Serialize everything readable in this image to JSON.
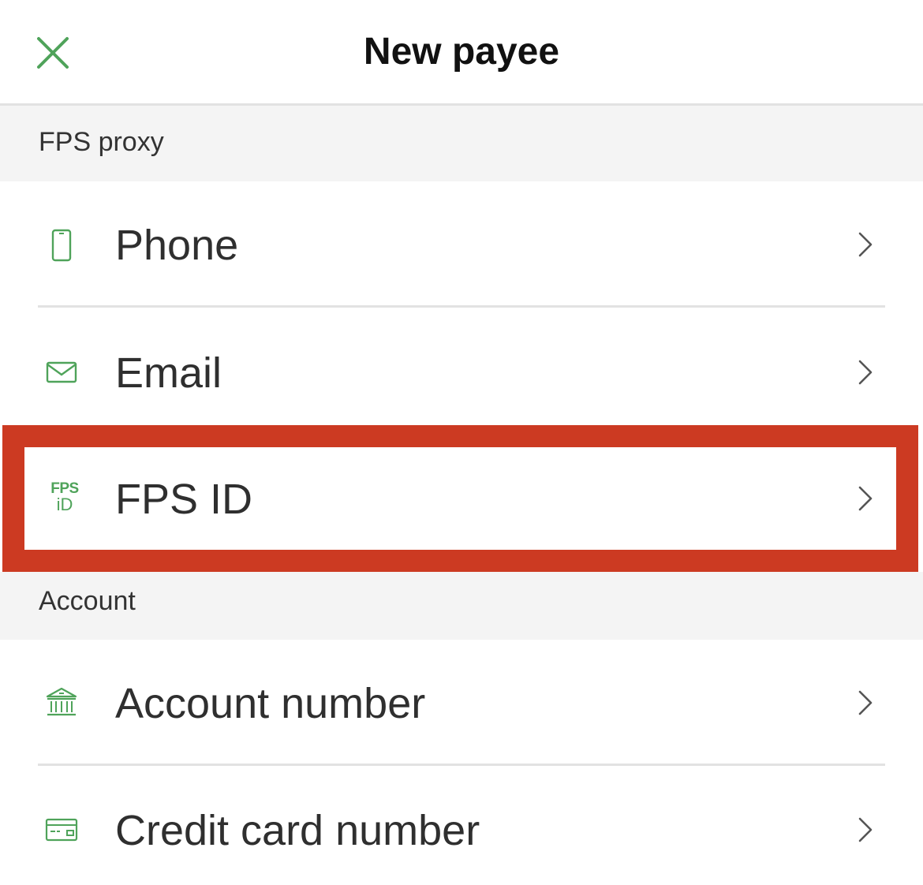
{
  "header": {
    "title": "New payee",
    "close_icon": "close-icon"
  },
  "colors": {
    "accent": "#4fa35a",
    "highlight": "#cc3a22",
    "section_bg": "#f4f4f4"
  },
  "sections": [
    {
      "title": "FPS proxy",
      "items": [
        {
          "label": "Phone",
          "icon": "phone-icon"
        },
        {
          "label": "Email",
          "icon": "mail-icon"
        },
        {
          "label": "FPS ID",
          "icon": "fps-id-icon",
          "icon_text_top": "FPS",
          "icon_text_bottom": "iD"
        }
      ]
    },
    {
      "title": "Account",
      "items": [
        {
          "label": "Account number",
          "icon": "bank-icon"
        },
        {
          "label": "Credit card number",
          "icon": "credit-card-icon"
        }
      ]
    }
  ]
}
